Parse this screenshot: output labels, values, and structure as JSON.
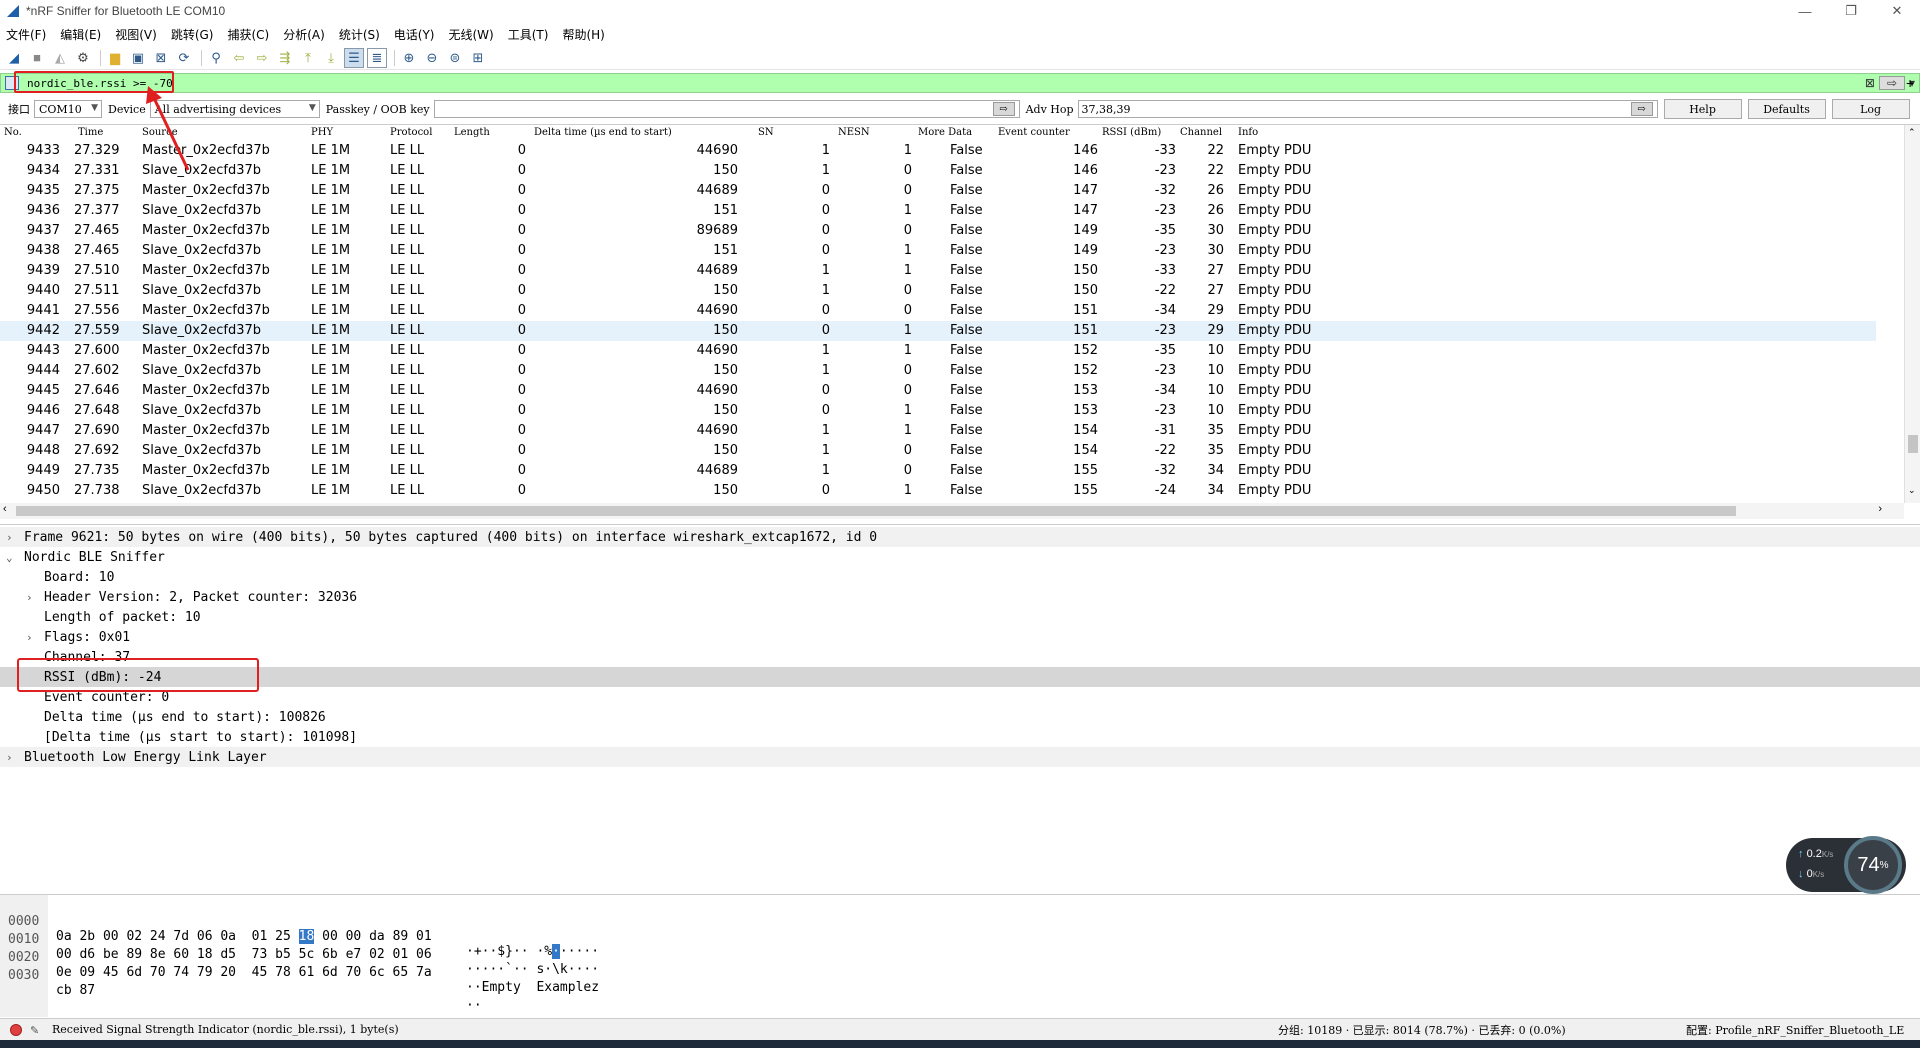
{
  "window": {
    "title": "*nRF Sniffer for Bluetooth LE COM10"
  },
  "menu": [
    "文件(F)",
    "编辑(E)",
    "视图(V)",
    "跳转(G)",
    "捕获(C)",
    "分析(A)",
    "统计(S)",
    "电话(Y)",
    "无线(W)",
    "工具(T)",
    "帮助(H)"
  ],
  "filter": {
    "value": "nordic_ble.rssi >= -70"
  },
  "iface": {
    "label": "接口",
    "port": "COM10",
    "device_label": "Device",
    "device_value": "All advertising devices",
    "passkey_label": "Passkey / OOB key",
    "advhop_label": "Adv Hop",
    "advhop_value": "37,38,39",
    "help": "Help",
    "defaults": "Defaults",
    "log": "Log"
  },
  "packet_list": {
    "columns": [
      "No.",
      "Time",
      "Source",
      "PHY",
      "Protocol",
      "Length",
      "Delta time (µs end to start)",
      "SN",
      "NESN",
      "More Data",
      "Event counter",
      "RSSI (dBm)",
      "Channel",
      "Info"
    ],
    "rows": [
      [
        "9433",
        "27.329",
        "Master_0x2ecfd37b",
        "LE 1M",
        "LE LL",
        "0",
        "44690",
        "1",
        "1",
        "False",
        "146",
        "-33",
        "22",
        "Empty PDU"
      ],
      [
        "9434",
        "27.331",
        "Slave_0x2ecfd37b",
        "LE 1M",
        "LE LL",
        "0",
        "150",
        "1",
        "0",
        "False",
        "146",
        "-23",
        "22",
        "Empty PDU"
      ],
      [
        "9435",
        "27.375",
        "Master_0x2ecfd37b",
        "LE 1M",
        "LE LL",
        "0",
        "44689",
        "0",
        "0",
        "False",
        "147",
        "-32",
        "26",
        "Empty PDU"
      ],
      [
        "9436",
        "27.377",
        "Slave_0x2ecfd37b",
        "LE 1M",
        "LE LL",
        "0",
        "151",
        "0",
        "1",
        "False",
        "147",
        "-23",
        "26",
        "Empty PDU"
      ],
      [
        "9437",
        "27.465",
        "Master_0x2ecfd37b",
        "LE 1M",
        "LE LL",
        "0",
        "89689",
        "0",
        "0",
        "False",
        "149",
        "-35",
        "30",
        "Empty PDU"
      ],
      [
        "9438",
        "27.465",
        "Slave_0x2ecfd37b",
        "LE 1M",
        "LE LL",
        "0",
        "151",
        "0",
        "1",
        "False",
        "149",
        "-23",
        "30",
        "Empty PDU"
      ],
      [
        "9439",
        "27.510",
        "Master_0x2ecfd37b",
        "LE 1M",
        "LE LL",
        "0",
        "44689",
        "1",
        "1",
        "False",
        "150",
        "-33",
        "27",
        "Empty PDU"
      ],
      [
        "9440",
        "27.511",
        "Slave_0x2ecfd37b",
        "LE 1M",
        "LE LL",
        "0",
        "150",
        "1",
        "0",
        "False",
        "150",
        "-22",
        "27",
        "Empty PDU"
      ],
      [
        "9441",
        "27.556",
        "Master_0x2ecfd37b",
        "LE 1M",
        "LE LL",
        "0",
        "44690",
        "0",
        "0",
        "False",
        "151",
        "-34",
        "29",
        "Empty PDU"
      ],
      [
        "9442",
        "27.559",
        "Slave_0x2ecfd37b",
        "LE 1M",
        "LE LL",
        "0",
        "150",
        "0",
        "1",
        "False",
        "151",
        "-23",
        "29",
        "Empty PDU"
      ],
      [
        "9443",
        "27.600",
        "Master_0x2ecfd37b",
        "LE 1M",
        "LE LL",
        "0",
        "44690",
        "1",
        "1",
        "False",
        "152",
        "-35",
        "10",
        "Empty PDU"
      ],
      [
        "9444",
        "27.602",
        "Slave_0x2ecfd37b",
        "LE 1M",
        "LE LL",
        "0",
        "150",
        "1",
        "0",
        "False",
        "152",
        "-23",
        "10",
        "Empty PDU"
      ],
      [
        "9445",
        "27.646",
        "Master_0x2ecfd37b",
        "LE 1M",
        "LE LL",
        "0",
        "44690",
        "0",
        "0",
        "False",
        "153",
        "-34",
        "10",
        "Empty PDU"
      ],
      [
        "9446",
        "27.648",
        "Slave_0x2ecfd37b",
        "LE 1M",
        "LE LL",
        "0",
        "150",
        "0",
        "1",
        "False",
        "153",
        "-23",
        "10",
        "Empty PDU"
      ],
      [
        "9447",
        "27.690",
        "Master_0x2ecfd37b",
        "LE 1M",
        "LE LL",
        "0",
        "44690",
        "1",
        "1",
        "False",
        "154",
        "-31",
        "35",
        "Empty PDU"
      ],
      [
        "9448",
        "27.692",
        "Slave_0x2ecfd37b",
        "LE 1M",
        "LE LL",
        "0",
        "150",
        "1",
        "0",
        "False",
        "154",
        "-22",
        "35",
        "Empty PDU"
      ],
      [
        "9449",
        "27.735",
        "Master_0x2ecfd37b",
        "LE 1M",
        "LE LL",
        "0",
        "44689",
        "1",
        "0",
        "False",
        "155",
        "-32",
        "34",
        "Empty PDU"
      ],
      [
        "9450",
        "27.738",
        "Slave_0x2ecfd37b",
        "LE 1M",
        "LE LL",
        "0",
        "150",
        "0",
        "1",
        "False",
        "155",
        "-24",
        "34",
        "Empty PDU"
      ]
    ],
    "selected_row": "9442"
  },
  "details": {
    "frame": "Frame 9621: 50 bytes on wire (400 bits), 50 bytes captured (400 bits) on interface wireshark_extcap1672, id 0",
    "nordic": "Nordic BLE Sniffer",
    "board": "Board: 10",
    "header": "Header Version: 2, Packet counter: 32036",
    "length": "Length of packet: 10",
    "flags": "Flags: 0x01",
    "channel": "Channel: 37",
    "rssi": "RSSI (dBm): -24",
    "event": "Event counter: 0",
    "delta": "Delta time (µs end to start): 100826",
    "delta2": "[Delta time (µs start to start): 101098]",
    "btle": "Bluetooth Low Energy Link Layer"
  },
  "bytes": [
    {
      "off": "0000",
      "hex_a": "0a 2b 00 02 24 7d 06 0a  01 25 ",
      "hl": "18",
      "hex_b": " 00 00 da 89 01",
      "asc_a": "·+··$}·· ·%",
      "asc_hl": "·",
      "asc_b": "·····"
    },
    {
      "off": "0010",
      "hex_a": "00 d6 be 89 8e 60 18 d5  73 b5 5c 6b e7 02 01 06",
      "hl": "",
      "hex_b": "",
      "asc_a": "·····`·· s·\\k····",
      "asc_hl": "",
      "asc_b": ""
    },
    {
      "off": "0020",
      "hex_a": "0e 09 45 6d 70 74 79 20  45 78 61 6d 70 6c 65 7a",
      "hl": "",
      "hex_b": "",
      "asc_a": "··Empty  Examplez",
      "asc_hl": "",
      "asc_b": ""
    },
    {
      "off": "0030",
      "hex_a": "cb 87",
      "hl": "",
      "hex_b": "",
      "asc_a": "··",
      "asc_hl": "",
      "asc_b": ""
    }
  ],
  "speed": {
    "up": "0.2",
    "up_unit": "K/s",
    "down": "0",
    "down_unit": "K/s",
    "cpu": "74",
    "cpu_unit": "%"
  },
  "status": {
    "field": "Received Signal Strength Indicator (nordic_ble.rssi), 1 byte(s)",
    "stats": "分组: 10189 · 已显示: 8014 (78.7%) · 已丢弃: 0 (0.0%)",
    "profile": "配置: Profile_nRF_Sniffer_Bluetooth_LE"
  },
  "colors": {
    "filter_bg": "#afffaf",
    "selection": "#e6f2fb",
    "annotation": "#e02020"
  }
}
